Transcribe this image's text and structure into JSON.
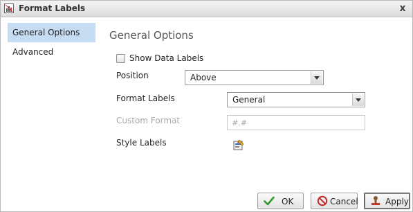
{
  "window": {
    "title": "Format Labels",
    "icon": "chart-labels-icon",
    "close_glyph": "x"
  },
  "nav": {
    "items": [
      {
        "label": "General Options",
        "selected": true
      },
      {
        "label": "Advanced",
        "selected": false
      }
    ]
  },
  "content": {
    "title": "General Options",
    "show_data_labels": {
      "label": "Show Data Labels",
      "checked": false
    },
    "position": {
      "label": "Position",
      "value": "Above"
    },
    "format_labels": {
      "label": "Format Labels",
      "value": "General"
    },
    "custom_format": {
      "label": "Custom Format",
      "placeholder": "#.#",
      "disabled": true
    },
    "style_labels": {
      "label": "Style Labels",
      "icon": "style-editor-icon"
    }
  },
  "buttons": {
    "ok": {
      "label": "OK",
      "icon": "checkmark-icon"
    },
    "cancel": {
      "label": "Cancel",
      "icon": "cancel-icon"
    },
    "apply": {
      "label": "Apply",
      "icon": "apply-stamp-icon"
    }
  },
  "colors": {
    "nav_selected_bg": "#c5dcf3",
    "ok_check": "#2e9a2e",
    "cancel_red": "#c62828"
  }
}
